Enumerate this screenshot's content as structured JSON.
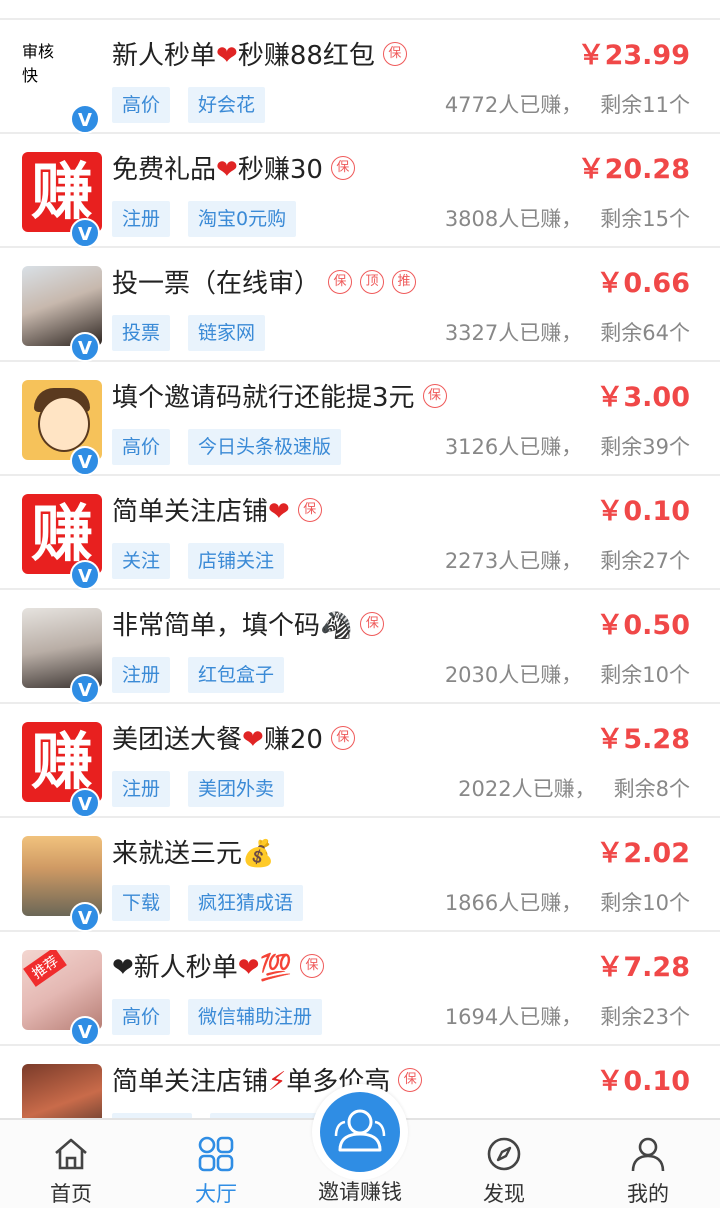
{
  "list": {
    "items": [
      {
        "avatar": "shenhe",
        "avatar_text1": "审核",
        "avatar_text2": "快",
        "title_pre": "新人秒单",
        "title_emoji": "❤",
        "title_post": "秒赚88红包",
        "badges": [
          "保"
        ],
        "price": "￥23.99",
        "tags": [
          "高价",
          "好会花"
        ],
        "earned": "4772人已赚，",
        "remain": "剩余11个"
      },
      {
        "avatar": "zhuan",
        "avatar_text1": "赚",
        "title_pre": "免费礼品",
        "title_emoji": "❤",
        "title_post": "秒赚30",
        "badges": [
          "保"
        ],
        "price": "￥20.28",
        "tags": [
          "注册",
          "淘宝0元购"
        ],
        "earned": "3808人已赚，",
        "remain": "剩余15个"
      },
      {
        "avatar": "photo1",
        "title_pre": "投一票（在线审）",
        "title_emoji": "",
        "title_post": "",
        "badges": [
          "保",
          "顶",
          "推"
        ],
        "price": "￥0.66",
        "tags": [
          "投票",
          "链家网"
        ],
        "earned": "3327人已赚，",
        "remain": "剩余64个"
      },
      {
        "avatar": "cartoon",
        "title_pre": "填个邀请码就行还能提3元",
        "title_emoji": "",
        "title_post": "",
        "badges": [
          "保"
        ],
        "price": "￥3.00",
        "tags": [
          "高价",
          "今日头条极速版"
        ],
        "earned": "3126人已赚，",
        "remain": "剩余39个"
      },
      {
        "avatar": "zhuan",
        "avatar_text1": "赚",
        "title_pre": "简单关注店铺",
        "title_emoji": "❤",
        "title_post": "",
        "badges": [
          "保"
        ],
        "price": "￥0.10",
        "tags": [
          "关注",
          "店铺关注"
        ],
        "earned": "2273人已赚，",
        "remain": "剩余27个"
      },
      {
        "avatar": "photo2",
        "title_pre": "非常简单，填个码",
        "title_emoji": "🦓",
        "title_post": "",
        "badges": [
          "保"
        ],
        "price": "￥0.50",
        "tags": [
          "注册",
          "红包盒子"
        ],
        "earned": "2030人已赚，",
        "remain": "剩余10个"
      },
      {
        "avatar": "zhuan",
        "avatar_text1": "赚",
        "title_pre": "美团送大餐",
        "title_emoji": "❤",
        "title_post": "赚20",
        "badges": [
          "保"
        ],
        "price": "￥5.28",
        "tags": [
          "注册",
          "美团外卖"
        ],
        "earned": "2022人已赚，",
        "remain": "剩余8个"
      },
      {
        "avatar": "photo3",
        "title_pre": "来就送三元",
        "title_emoji": "💰",
        "title_post": "",
        "badges": [],
        "price": "￥2.02",
        "tags": [
          "下载",
          "疯狂猜成语"
        ],
        "earned": "1866人已赚，",
        "remain": "剩余10个"
      },
      {
        "avatar": "photo4",
        "avatar_tag": "推荐",
        "title_pre": "❤新人秒单",
        "title_emoji": "❤",
        "title_post": "💯",
        "badges": [
          "保"
        ],
        "price": "￥7.28",
        "tags": [
          "高价",
          "微信辅助注册"
        ],
        "earned": "1694人已赚，",
        "remain": "剩余23个"
      },
      {
        "avatar": "photo5",
        "title_pre": "简单关注店铺",
        "title_emoji": "⚡",
        "title_post": "单多价高",
        "badges": [
          "保"
        ],
        "price": "￥0.10",
        "tags": [
          "",
          ""
        ],
        "earned": "",
        "remain": ""
      }
    ]
  },
  "tabbar": {
    "home": "首页",
    "hall": "大厅",
    "invite": "邀请赚钱",
    "discover": "发现",
    "mine": "我的"
  },
  "colors": {
    "accent": "#2f8de4",
    "price": "#f04848",
    "tag_bg": "#e9f3fc"
  }
}
